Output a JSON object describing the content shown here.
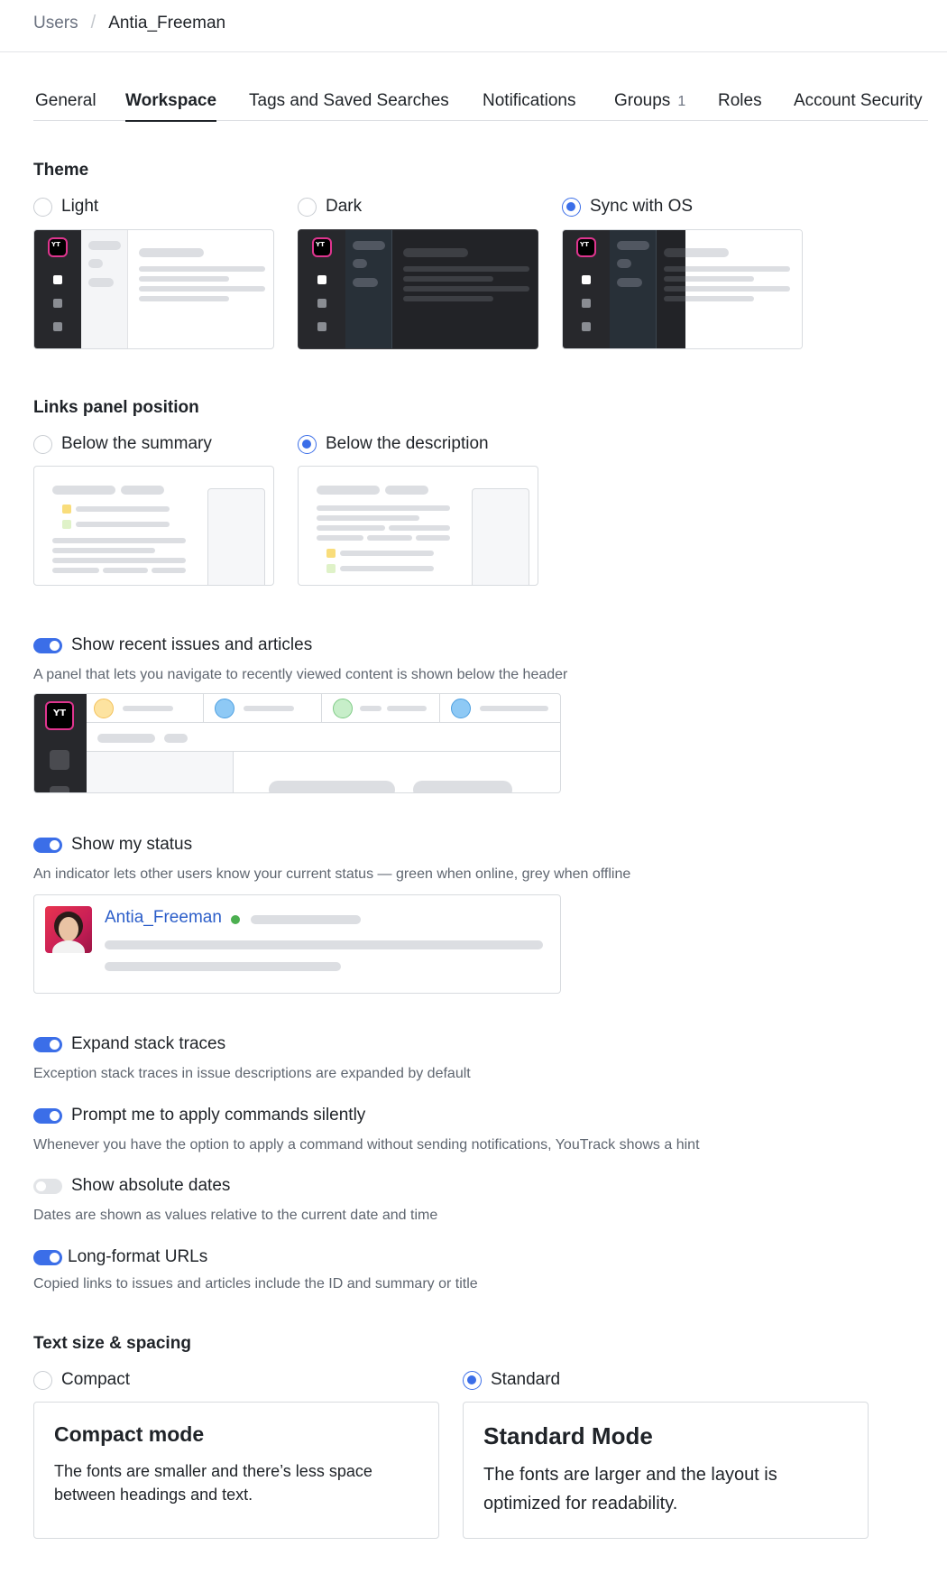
{
  "breadcrumb": {
    "parent": "Users",
    "separator": "/",
    "current": "Antia_Freeman"
  },
  "tabs": [
    {
      "label": "General"
    },
    {
      "label": "Workspace",
      "active": true
    },
    {
      "label": "Tags and Saved Searches"
    },
    {
      "label": "Notifications"
    },
    {
      "label": "Groups",
      "count": "1"
    },
    {
      "label": "Roles"
    },
    {
      "label": "Account Security"
    }
  ],
  "theme": {
    "title": "Theme",
    "options": [
      {
        "label": "Light",
        "checked": false
      },
      {
        "label": "Dark",
        "checked": false
      },
      {
        "label": "Sync with OS",
        "checked": true
      }
    ]
  },
  "links_panel": {
    "title": "Links panel position",
    "options": [
      {
        "label": "Below the summary",
        "checked": false
      },
      {
        "label": "Below the description",
        "checked": true
      }
    ]
  },
  "toggles": {
    "recent": {
      "label": "Show recent issues and articles",
      "hint": "A panel that lets you navigate to recently viewed content is shown below the header",
      "on": true
    },
    "status": {
      "label": "Show my status",
      "hint": "An indicator lets other users know your current status — green when online, grey when offline",
      "on": true
    },
    "stack": {
      "label": "Expand stack traces",
      "hint": "Exception stack traces in issue descriptions are expanded by default",
      "on": true
    },
    "commands": {
      "label": "Prompt me to apply commands silently",
      "hint": "Whenever you have the option to apply a command without sending notifications, YouTrack shows a hint",
      "on": true
    },
    "dates": {
      "label": "Show absolute dates",
      "hint": "Dates are shown as values relative to the current date and time",
      "on": false
    },
    "urls": {
      "label": "Long-format URLs",
      "hint": "Copied links to issues and articles include the ID and summary or title",
      "on": true
    }
  },
  "status_preview": {
    "name": "Antia_Freeman",
    "status_color": "#4caf50"
  },
  "text_size": {
    "title": "Text size & spacing",
    "options": [
      {
        "label": "Compact",
        "checked": false,
        "card_title": "Compact mode",
        "card_desc_1": "The fonts are smaller and there’s less space",
        "card_desc_2": "between headings and text."
      },
      {
        "label": "Standard",
        "checked": true,
        "card_title": "Standard Mode",
        "card_desc_1": "The fonts are larger and the layout is",
        "card_desc_2": "optimized for readability."
      }
    ]
  },
  "colors": {
    "accent": "#3b6ee8",
    "sidebar_dark": "#27282c",
    "logo_pink": "#e0358f"
  }
}
